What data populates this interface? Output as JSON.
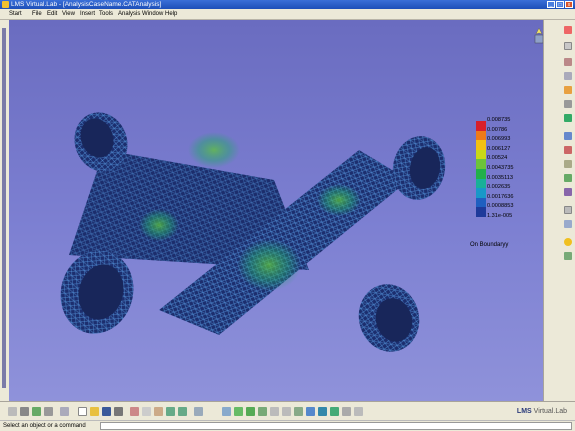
{
  "window": {
    "title": "LMS Virtual.Lab - [AnalysisCaseName.CATAnalysis]",
    "buttons": {
      "minimize": "_",
      "maximize": "□",
      "close": "x"
    }
  },
  "menu": [
    "Start",
    "File",
    "Edit",
    "View",
    "Insert",
    "Tools",
    "Analysis",
    "Window",
    "Help"
  ],
  "legend": {
    "values": [
      "0.008735",
      "0.00786",
      "0.006993",
      "0.006127",
      "0.00524",
      "0.0043735",
      "0.0035113",
      "0.002635",
      "0.0017636",
      "0.0008853",
      "1.31e-005"
    ],
    "colors": [
      "#d8202a",
      "#ee7a18",
      "#f2c010",
      "#c8d818",
      "#6cc43a",
      "#22b04a",
      "#18b098",
      "#1898c8",
      "#1f5fc0",
      "#1e3a9a"
    ],
    "caption": "On Boundaryy"
  },
  "brand": {
    "name": "LMS",
    "product": "Virtual.Lab"
  },
  "status": {
    "prompt": "Select an object or a command"
  },
  "colors": {
    "viewport_top": "#6a6cc0",
    "viewport_bottom": "#8f92da",
    "mesh": "#1c2e6e",
    "titlebar": "#1d4fb8"
  }
}
